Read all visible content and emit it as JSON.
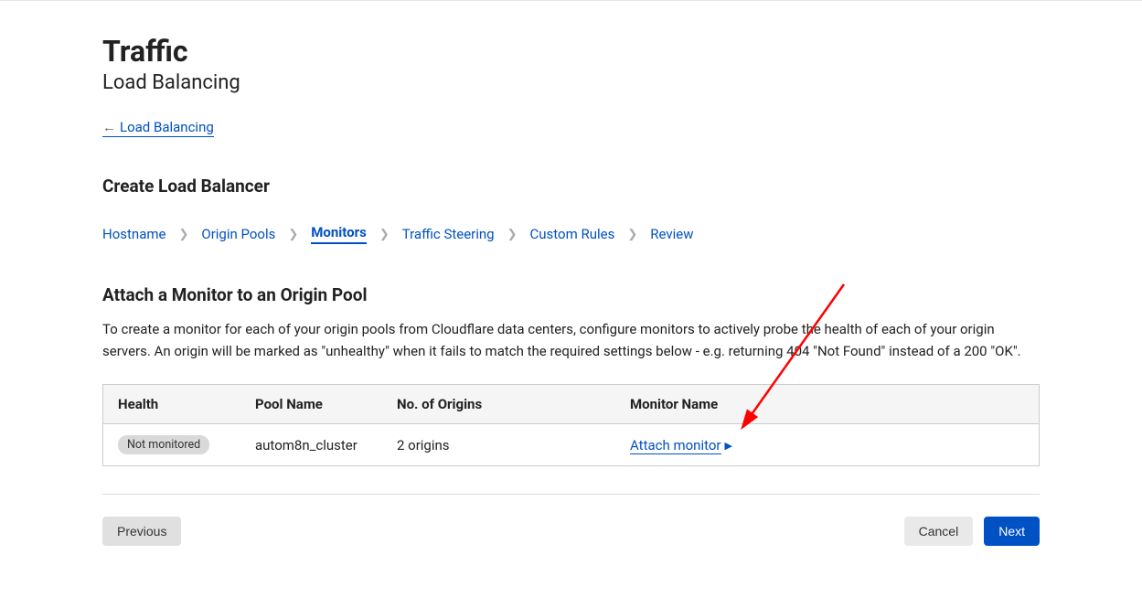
{
  "header": {
    "title": "Traffic",
    "subtitle": "Load Balancing",
    "back_link": " Load Balancing"
  },
  "section": {
    "heading": "Create Load Balancer",
    "sub_heading": "Attach a Monitor to an Origin Pool",
    "description": "To create a monitor for each of your origin pools from Cloudflare data centers, configure monitors to actively probe the health of each of your origin servers. An origin will be marked as \"unhealthy\" when it fails to match the required settings below - e.g. returning 404 \"Not Found\" instead of a 200 \"OK\"."
  },
  "wizard": {
    "steps": [
      "Hostname",
      "Origin Pools",
      "Monitors",
      "Traffic Steering",
      "Custom Rules",
      "Review"
    ],
    "active": "Monitors"
  },
  "table": {
    "headers": {
      "health": "Health",
      "pool_name": "Pool Name",
      "no_origins": "No. of Origins",
      "monitor_name": "Monitor Name"
    },
    "rows": [
      {
        "health_badge": "Not monitored",
        "pool_name": "autom8n_cluster",
        "no_origins": "2 origins",
        "monitor_action": "Attach monitor"
      }
    ]
  },
  "buttons": {
    "previous": "Previous",
    "cancel": "Cancel",
    "next": "Next"
  }
}
